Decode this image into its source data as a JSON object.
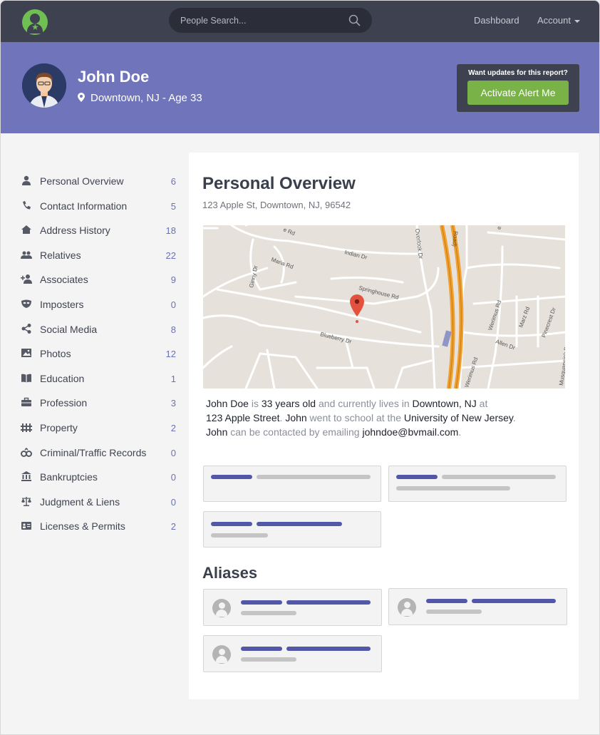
{
  "nav": {
    "search_placeholder": "People Search...",
    "dashboard": "Dashboard",
    "account": "Account"
  },
  "profile": {
    "name": "John Doe",
    "location": "Downtown, NJ - Age 33"
  },
  "alert": {
    "question": "Want updates for this report?",
    "button": "Activate Alert Me"
  },
  "sidebar": {
    "items": [
      {
        "label": "Personal Overview",
        "count": "6",
        "icon": "person-icon"
      },
      {
        "label": "Contact Information",
        "count": "5",
        "icon": "phone-icon"
      },
      {
        "label": "Address History",
        "count": "18",
        "icon": "home-icon"
      },
      {
        "label": "Relatives",
        "count": "22",
        "icon": "group-icon"
      },
      {
        "label": "Associates",
        "count": "9",
        "icon": "add-person-icon"
      },
      {
        "label": "Imposters",
        "count": "0",
        "icon": "mask-icon"
      },
      {
        "label": "Social Media",
        "count": "8",
        "icon": "share-icon"
      },
      {
        "label": "Photos",
        "count": "12",
        "icon": "photo-icon"
      },
      {
        "label": "Education",
        "count": "1",
        "icon": "book-icon"
      },
      {
        "label": "Profession",
        "count": "3",
        "icon": "briefcase-icon"
      },
      {
        "label": "Property",
        "count": "2",
        "icon": "fence-icon"
      },
      {
        "label": "Criminal/Traffic Records",
        "count": "0",
        "icon": "handcuffs-icon"
      },
      {
        "label": "Bankruptcies",
        "count": "0",
        "icon": "bank-icon"
      },
      {
        "label": "Judgment & Liens",
        "count": "0",
        "icon": "scales-icon"
      },
      {
        "label": "Licenses & Permits",
        "count": "2",
        "icon": "id-card-icon"
      }
    ]
  },
  "overview": {
    "title": "Personal Overview",
    "address": "123 Apple St, Downtown, NJ, 96542",
    "summary": {
      "name": "John Doe",
      "t1": " is ",
      "age": "33 years old",
      "t2": " and currently lives in ",
      "city": "Downtown, NJ",
      "t3": " at ",
      "street": "123 Apple Street",
      "t4": ". ",
      "first": "John",
      "t5": " went to school at the ",
      "school": "University of New Jersey",
      "t6": ".",
      "first2": "John",
      "t7": " can be contacted by emailing ",
      "email": "johndoe@bvmail.com",
      "t8": "."
    }
  },
  "map": {
    "streets": [
      "Indian Dr",
      "Maria Rd",
      "Ginny Dr",
      "Springhouse Rd",
      "Blueberry Dr",
      "Overlook Dr",
      "Werimus Rd",
      "Werimus Rd",
      "Allen Dr",
      "Marz Rd",
      "Pinecrest Dr",
      "Musquapsink Brook"
    ],
    "road_color": "#f0a030",
    "pin_color": "#e2523e"
  },
  "aliases": {
    "title": "Aliases"
  },
  "colors": {
    "nav": "#3d4150",
    "header": "#6f74bb",
    "accent": "#79b347",
    "count": "#6a70b8"
  }
}
